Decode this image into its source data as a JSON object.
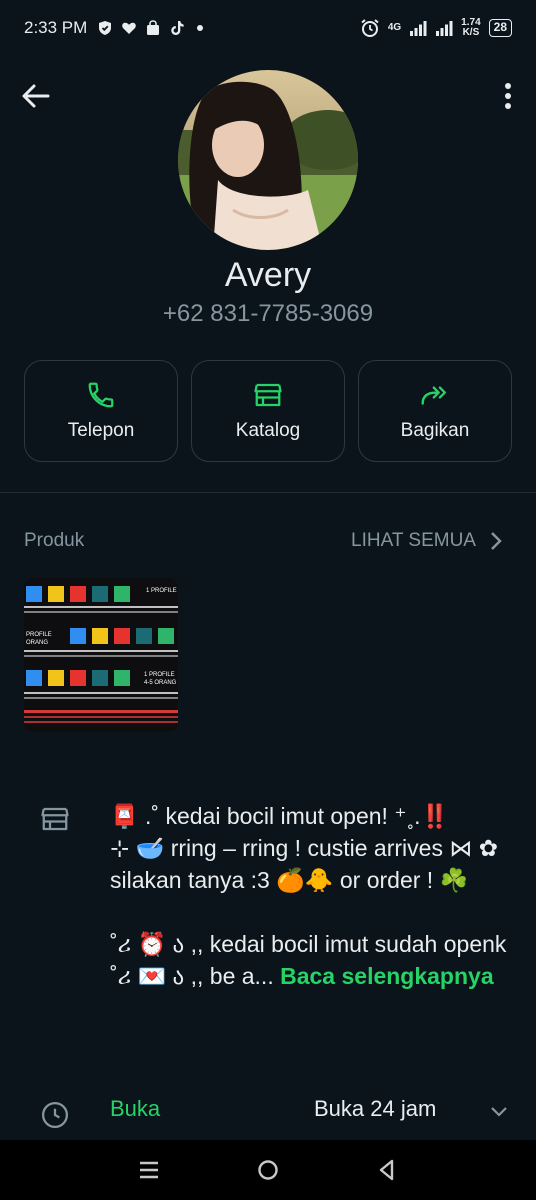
{
  "status_bar": {
    "time": "2:33 PM",
    "network": "4G",
    "speed_value": "1.74",
    "speed_unit": "K/S",
    "battery": "28",
    "icons": [
      "shield-icon",
      "heart-icon",
      "shopping-bag-icon",
      "tiktok-icon",
      "dot-icon",
      "alarm-icon",
      "signal-icon",
      "signal-icon"
    ]
  },
  "header": {
    "back_icon": "arrow-left-icon",
    "menu_icon": "more-vertical-icon"
  },
  "profile": {
    "name": "Avery",
    "phone": "+62 831-7785-3069"
  },
  "actions": [
    {
      "label": "Telepon",
      "icon": "phone-icon"
    },
    {
      "label": "Katalog",
      "icon": "store-icon"
    },
    {
      "label": "Bagikan",
      "icon": "share-icon"
    }
  ],
  "products": {
    "title": "Produk",
    "see_all": "LIHAT SEMUA",
    "item_text": {
      "row1": "1 PROFILE",
      "row2": "PROFILE",
      "row2b": "ORANG",
      "row3": "1 PROFILE",
      "row3b": "4-5 ORANG"
    }
  },
  "about": {
    "line1": "📮 .˚ kedai bocil imut open! ⁺˳.‼️",
    "line2": "⊹ 🥣 rring – rring ! custie arrives ⋈ ✿",
    "line3": "silakan tanya :3 🍊🐥 or order ! ☘️",
    "line4": "˚ሪ ⏰ ა ,, kedai bocil imut sudah openk",
    "line5": "˚ሪ 💌 ა ,, be a...",
    "read_more": "Baca selengkapnya"
  },
  "hours": {
    "status": "Buka",
    "detail": "Buka 24 jam"
  },
  "colors": {
    "background": "#0b141a",
    "accent": "#25d366",
    "secondary_text": "#8696a0",
    "border": "#2a3942"
  }
}
